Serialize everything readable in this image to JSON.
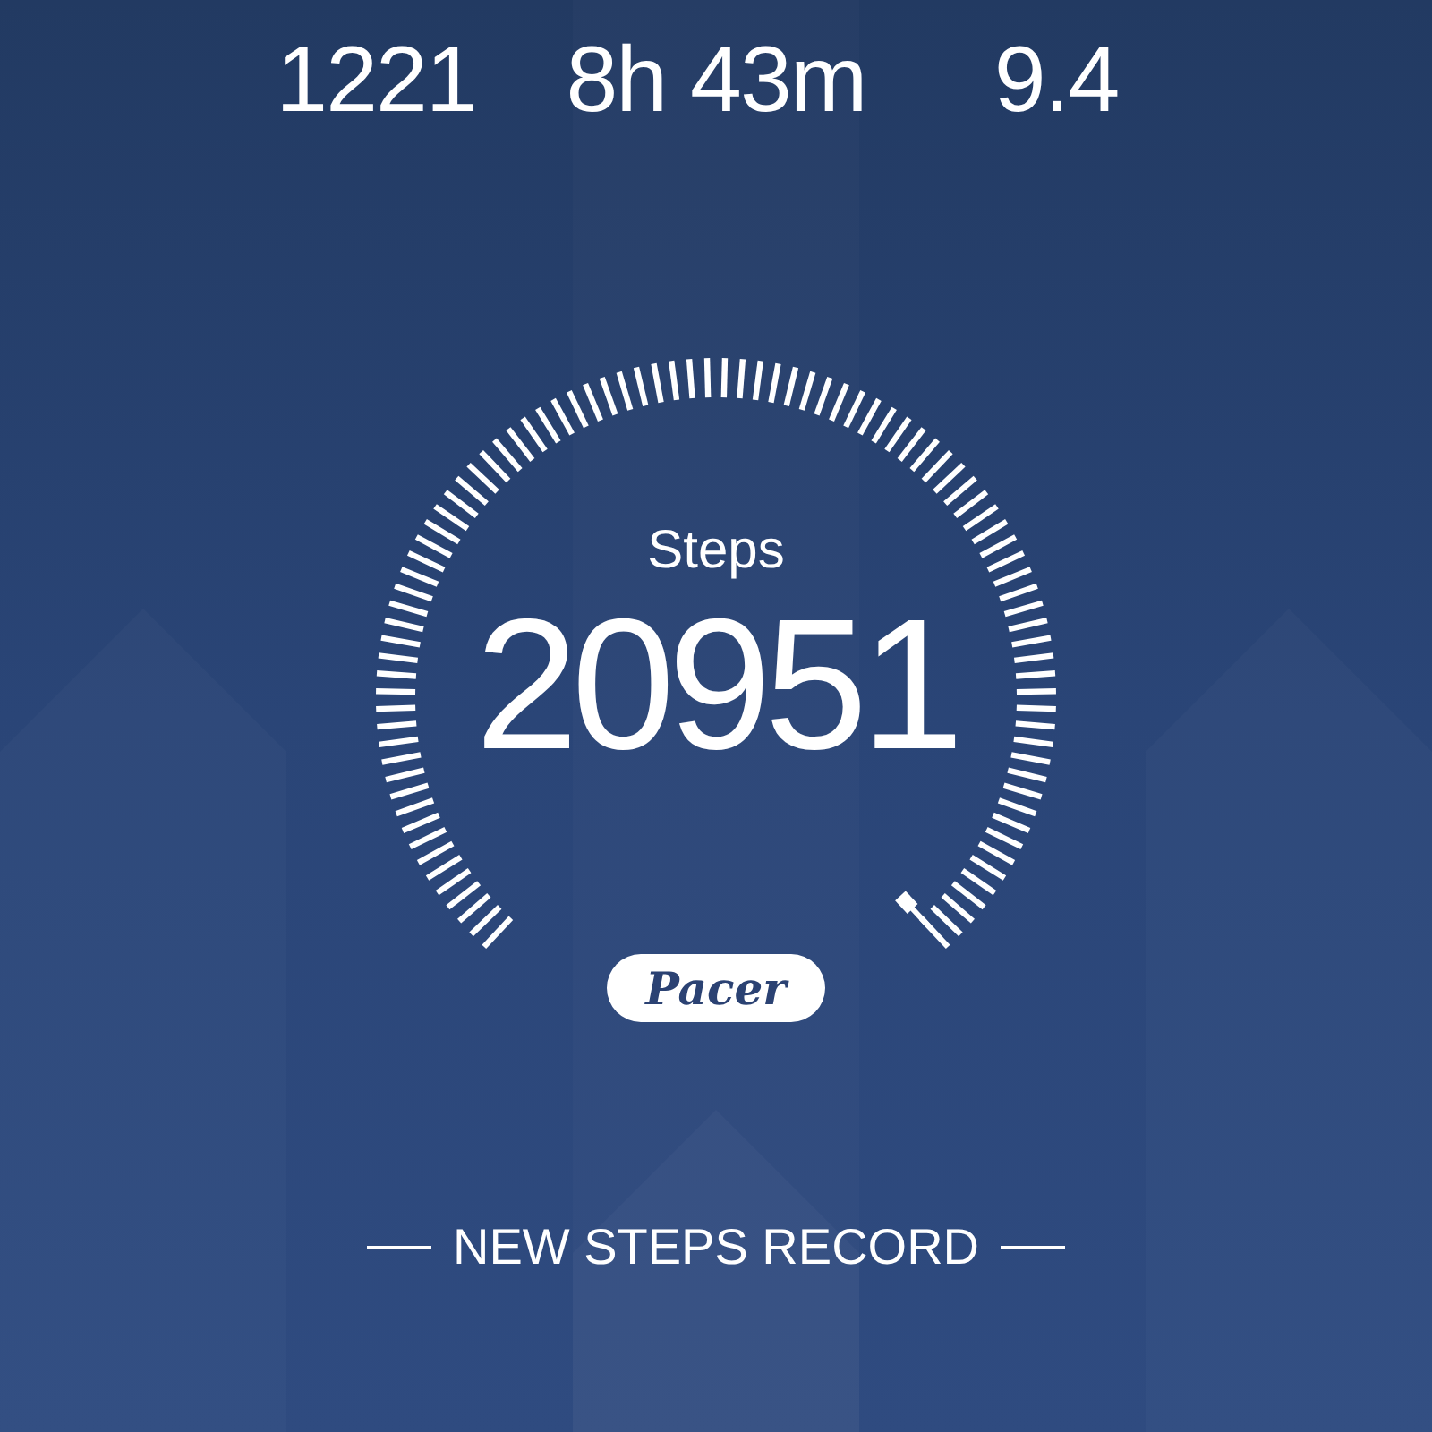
{
  "stats": [
    {
      "value": "1221"
    },
    {
      "value": "8h 43m"
    },
    {
      "value": "9.4"
    }
  ],
  "gauge": {
    "label": "Steps",
    "value": "20951"
  },
  "brand": {
    "logo": "Pacer"
  },
  "banner": {
    "text": "NEW STEPS RECORD"
  }
}
